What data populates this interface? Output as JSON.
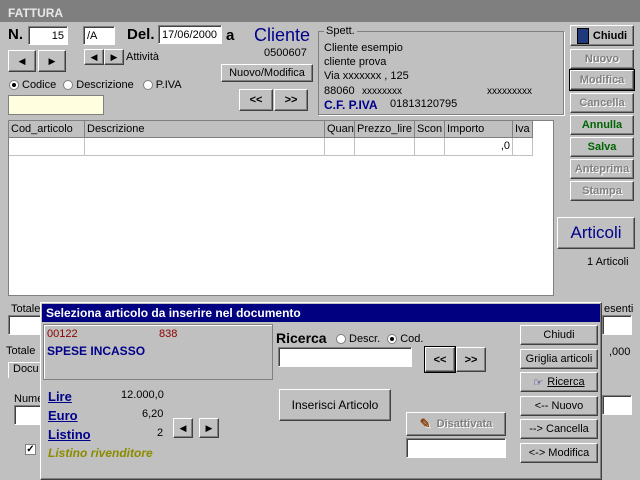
{
  "window": {
    "title": "FATTURA"
  },
  "header": {
    "n_label": "N.",
    "number": "15",
    "suffix": "/A",
    "del_label": "Del.",
    "date": "17/06/2000",
    "a_label": "a",
    "attivita_label": "Attività",
    "cliente_label": "Cliente",
    "cliente_code": "0500607",
    "nuovo_modifica": "Nuovo/Modifica",
    "prev_label": "<<",
    "next_label": ">>"
  },
  "search_mode": {
    "options": [
      "Codice",
      "Descrizione",
      "P.IVA"
    ],
    "selected": "Codice"
  },
  "spett": {
    "label": "Spett.",
    "line1": "Cliente esempio",
    "line2": "cliente prova",
    "line3": "Via xxxxxxx , 125",
    "cap": "88060",
    "city": "xxxxxxxx",
    "prov": "xxxxxxxxx",
    "cf_label": "C.F. P.IVA",
    "cf_value": "01813120795"
  },
  "grid": {
    "columns": [
      "Cod_articolo",
      "Descrizione",
      "Quan",
      "Prezzo_lire",
      "Scon",
      "Importo",
      "Iva"
    ],
    "row": [
      "",
      "",
      "",
      "",
      "",
      ",0",
      ""
    ]
  },
  "side_buttons": {
    "chiudi": "Chiudi",
    "nuovo": "Nuovo",
    "modifica": "Modifica",
    "cancella": "Cancella",
    "annulla": "Annulla",
    "salva": "Salva",
    "anteprima": "Anteprima",
    "stampa": "Stampa",
    "articoli": "Articoli",
    "articoli_count": "1 Articoli"
  },
  "bottom": {
    "totale1": "Totale",
    "totale2": "Totale",
    "docu": "Docu",
    "nume": "Nume",
    "esenti": "esenti",
    "zero": ",000"
  },
  "dialog": {
    "title": "Seleziona articolo da inserire nel documento",
    "code": "00122",
    "code2": "838",
    "description": "SPESE INCASSO",
    "ricerca_label": "Ricerca",
    "radio_descr": "Descr.",
    "radio_cod": "Cod.",
    "radio_selected": "Cod.",
    "prev": "<<",
    "next": ">>",
    "lire_label": "Lire",
    "lire_value": "12.000,0",
    "euro_label": "Euro",
    "euro_value": "6,20",
    "listino_label": "Listino",
    "listino_value": "2",
    "listino_name": "Listino rivenditore",
    "inserisci": "Inserisci Articolo",
    "disattivata": "Disattivata",
    "btn_chiudi": "Chiudi",
    "btn_griglia": "Griglia articoli",
    "btn_ricerca": "Ricerca",
    "btn_nuovo": "<-- Nuovo",
    "btn_cancella": "--> Cancella",
    "btn_modifica": "<-> Modifica"
  }
}
